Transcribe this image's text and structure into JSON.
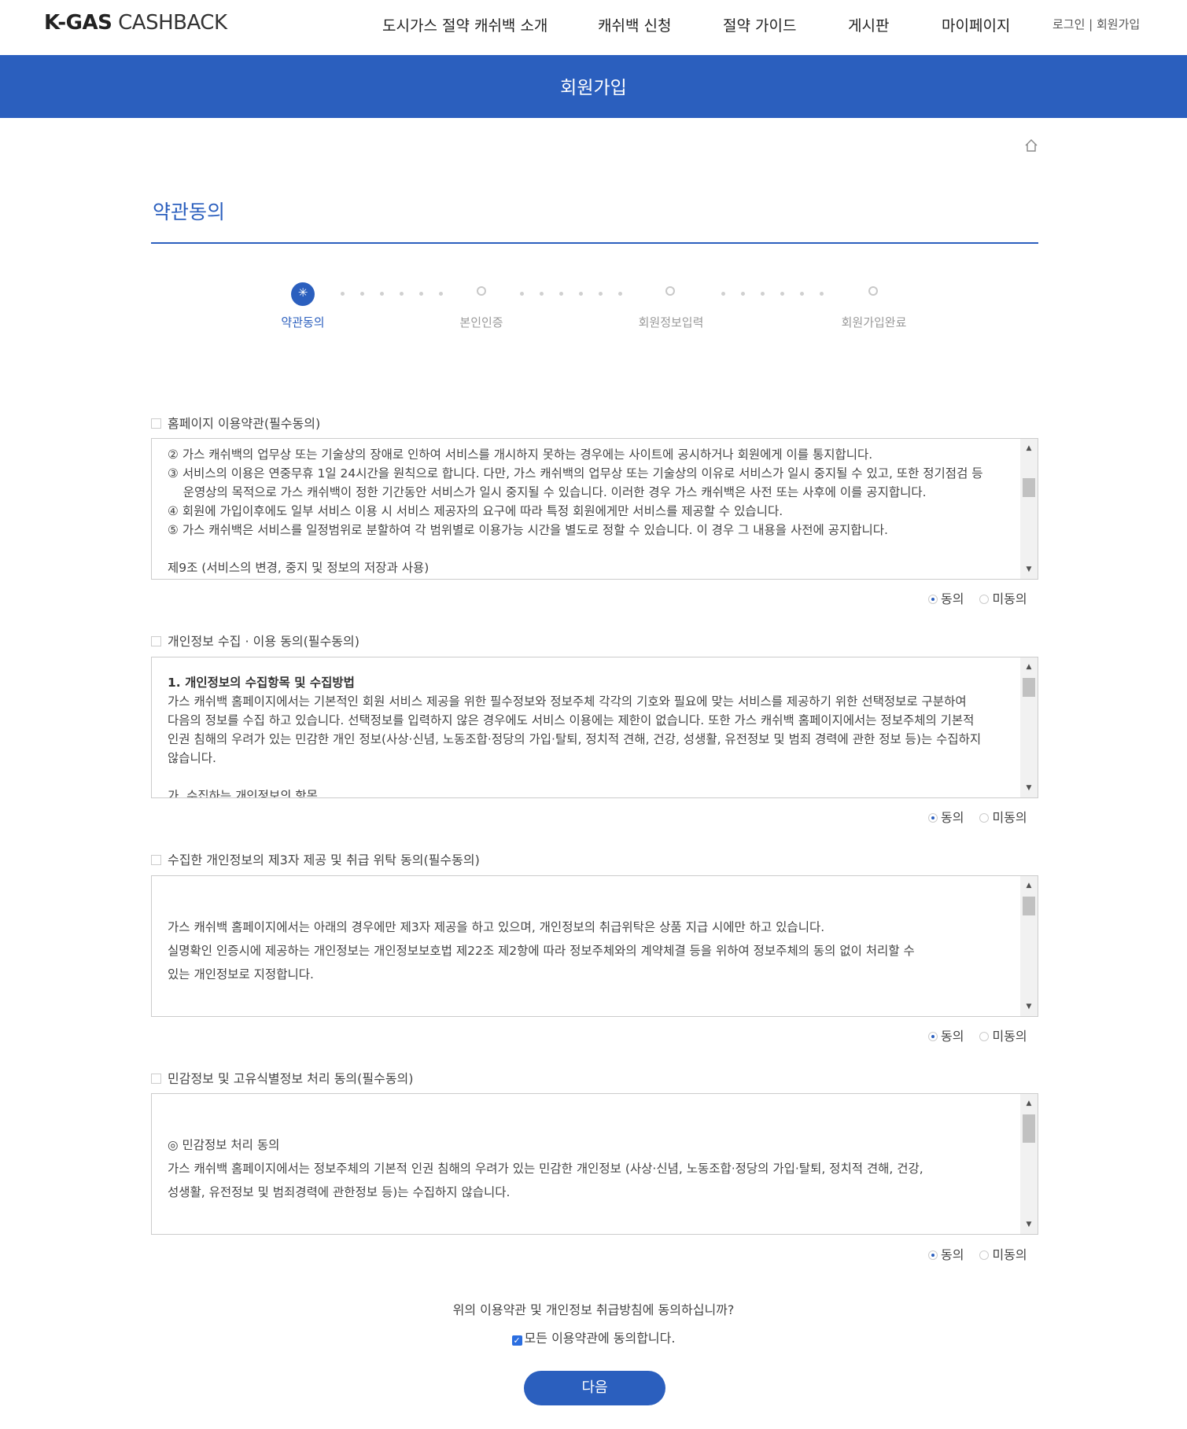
{
  "header": {
    "logo_bold": "K-GAS",
    "logo_light": " CASHBACK",
    "nav": [
      "도시가스 절약 캐쉬백 소개",
      "캐쉬백 신청",
      "절약 가이드",
      "게시판",
      "마이페이지"
    ],
    "login": "로그인",
    "separator": " | ",
    "signup": "회원가입"
  },
  "banner": {
    "title": "회원가입"
  },
  "section": {
    "title": "약관동의"
  },
  "steps": {
    "items": [
      "약관동의",
      "본인인증",
      "회원정보입력",
      "회원가입완료"
    ],
    "current": 1
  },
  "terms": [
    {
      "title": "홈페이지 이용약관(필수동의)",
      "lines": [
        "② 가스 캐쉬백의 업무상 또는 기술상의 장애로 인하여 서비스를 개시하지 못하는 경우에는 사이트에 공시하거나 회원에게 이를 통지합니다.",
        "③ 서비스의 이용은 연중무휴 1일 24시간을 원칙으로 합니다. 다만, 가스 캐쉬백의 업무상 또는 기술상의 이유로 서비스가 일시 중지될 수 있고, 또한 정기점검 등",
        "    운영상의 목적으로 가스 캐쉬백이 정한 기간동안 서비스가 일시 중지될 수 있습니다. 이러한 경우 가스 캐쉬백은 사전 또는 사후에 이를 공지합니다.",
        "④ 회원에 가입이후에도 일부 서비스 이용 시 서비스 제공자의 요구에 따라 특정 회원에게만 서비스를 제공할 수 있습니다.",
        "⑤ 가스 캐쉬백은 서비스를 일정범위로 분할하여 각 범위별로 이용가능 시간을 별도로 정할 수 있습니다. 이 경우 그 내용을 사전에 공지합니다.",
        "",
        "제9조 (서비스의 변경, 중지 및 정보의 저장과 사용)"
      ],
      "agree": "동의",
      "disagree": "미동의"
    },
    {
      "title": "개인정보 수집 · 이용 동의(필수동의)",
      "heading": "1. 개인정보의 수집항목 및 수집방법",
      "lines": [
        "가스 캐쉬백 홈페이지에서는 기본적인 회원 서비스 제공을 위한 필수정보와 정보주체 각각의 기호와 필요에 맞는 서비스를 제공하기 위한 선택정보로 구분하여",
        "다음의 정보를 수집 하고 있습니다. 선택정보를 입력하지 않은 경우에도 서비스 이용에는 제한이 없습니다. 또한 가스 캐쉬백 홈페이지에서는 정보주체의 기본적",
        "인권 침해의 우려가 있는 민감한 개인 정보(사상·신념, 노동조합·정당의 가입·탈퇴, 정치적 견해, 건강, 성생활, 유전정보 및 범죄 경력에 관한 정보 등)는 수집하지",
        "않습니다.",
        "",
        "가. 수집하는 개인정보의 항목"
      ],
      "agree": "동의",
      "disagree": "미동의"
    },
    {
      "title": "수집한 개인정보의 제3자 제공 및 취급 위탁 동의(필수동의)",
      "lines": [
        "가스 캐쉬백 홈페이지에서는 아래의 경우에만 제3자 제공을 하고 있으며, 개인정보의 취급위탁은 상품 지급 시에만 하고 있습니다.",
        "실명확인 인증시에 제공하는 개인정보는 개인정보보호법 제22조 제2항에 따라 정보주체와의 계약체결 등을 위하여 정보주체의 동의 없이 처리할 수",
        "있는 개인정보로 지정합니다."
      ],
      "agree": "동의",
      "disagree": "미동의"
    },
    {
      "title": "민감정보 및 고유식별정보 처리 동의(필수동의)",
      "lines": [
        "◎ 민감정보 처리 동의",
        "가스 캐쉬백 홈페이지에서는 정보주체의 기본적 인권 침해의 우려가 있는 민감한 개인정보 (사상·신념, 노동조합·정당의 가입·탈퇴, 정치적 견해, 건강,",
        "성생활, 유전정보 및 범죄경력에 관한정보 등)는 수집하지 않습니다."
      ],
      "agree": "동의",
      "disagree": "미동의"
    }
  ],
  "footer": {
    "question": "위의 이용약관 및 개인정보 취급방침에 동의하십니까?",
    "all_agree": "모든 이용약관에 동의합니다.",
    "all_agree_checked": true,
    "next": "다음"
  },
  "icons": {
    "home": "home-icon",
    "step_active": "spinner-icon",
    "scroll_up": "triangle-up-icon",
    "scroll_down": "triangle-down-icon"
  },
  "colors": {
    "primary": "#2b5fbe",
    "step_inactive": "#c8c8c8",
    "text": "#444444"
  }
}
